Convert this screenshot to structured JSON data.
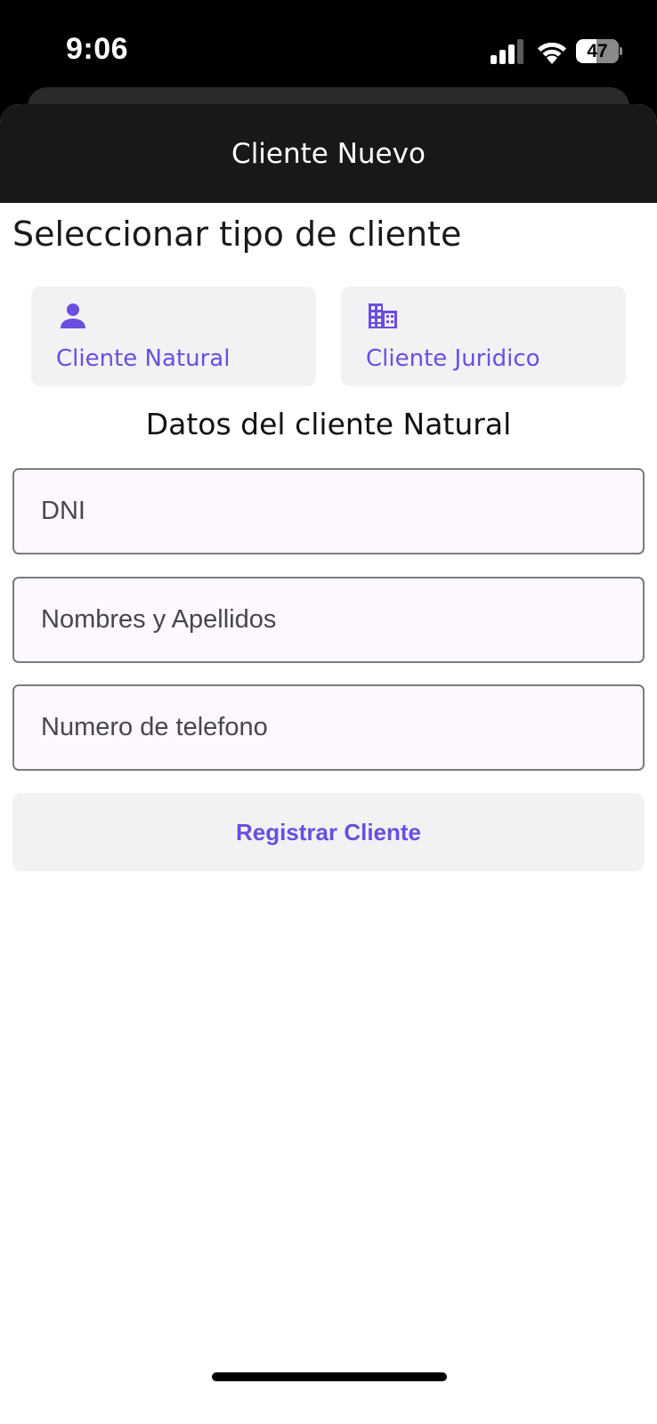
{
  "status_bar": {
    "time": "9:06",
    "battery_level": "47",
    "icons": [
      "cellular-signal-icon",
      "wifi-icon",
      "battery-icon"
    ]
  },
  "nav": {
    "title": "Cliente Nuevo"
  },
  "client_type": {
    "heading": "Seleccionar tipo de cliente",
    "options": [
      {
        "label": "Cliente Natural",
        "icon": "person-icon"
      },
      {
        "label": "Cliente Juridico",
        "icon": "building-icon"
      }
    ]
  },
  "form": {
    "heading": "Datos del cliente Natural",
    "fields": [
      {
        "placeholder": "DNI",
        "value": ""
      },
      {
        "placeholder": "Nombres y Apellidos",
        "value": ""
      },
      {
        "placeholder": "Numero de telefono",
        "value": ""
      }
    ],
    "submit_label": "Registrar Cliente"
  },
  "colors": {
    "accent": "#6a4ee0",
    "nav_background": "#18181a",
    "card_background": "#f2f2f4",
    "field_background": "#fdf8fd",
    "field_border": "#7d7a80"
  }
}
